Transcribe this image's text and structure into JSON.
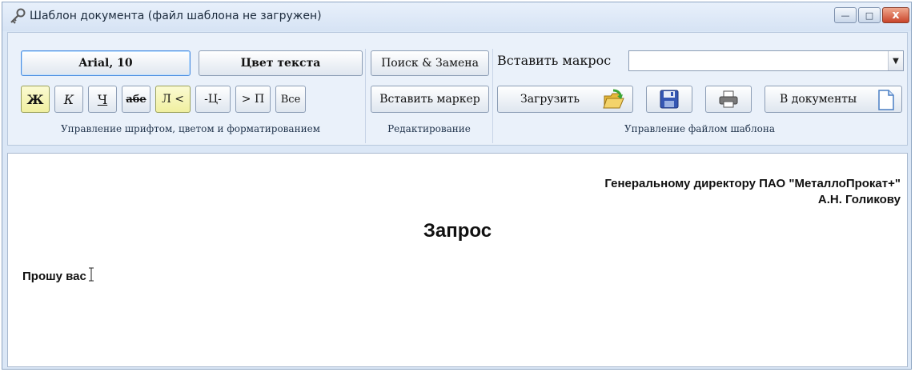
{
  "window": {
    "title": "Шаблон документа (файл шаблона не загружен)",
    "minimize_glyph": "—",
    "maximize_glyph": "□",
    "close_glyph": "x"
  },
  "toolbar": {
    "font_button": "Arial, 10",
    "text_color_button": "Цвет текста",
    "find_replace_button": "Поиск & Замена",
    "insert_macro_label": "Вставить макрос",
    "insert_macro_value": "",
    "format_buttons": {
      "bold": "Ж",
      "italic": "К",
      "underline": "Ч",
      "strike": "абе",
      "align_left": "Л <",
      "align_center": "-Ц-",
      "align_right": "> П",
      "justify": "Все"
    },
    "insert_marker_button": "Вставить маркер",
    "load_button": "Загрузить",
    "to_documents_button": "В документы",
    "groups": {
      "font": "Управление шрифтом, цветом и форматированием",
      "editing": "Редактирование",
      "template": "Управление файлом шаблона"
    }
  },
  "document": {
    "recipient_line1": "Генеральному директору ПАО \"МеталлоПрокат+\"",
    "recipient_line2": "А.Н. Голикову",
    "title": "Запрос",
    "body": "Прошу вас"
  },
  "icons": {
    "app": "key-icon",
    "load": "folder-open-icon",
    "save": "save-icon",
    "print": "printer-icon",
    "to_documents": "document-icon"
  },
  "colors": {
    "active_button": "#f4f3b0",
    "window_frame": "#dbe7f6",
    "close_button": "#c9442a"
  }
}
